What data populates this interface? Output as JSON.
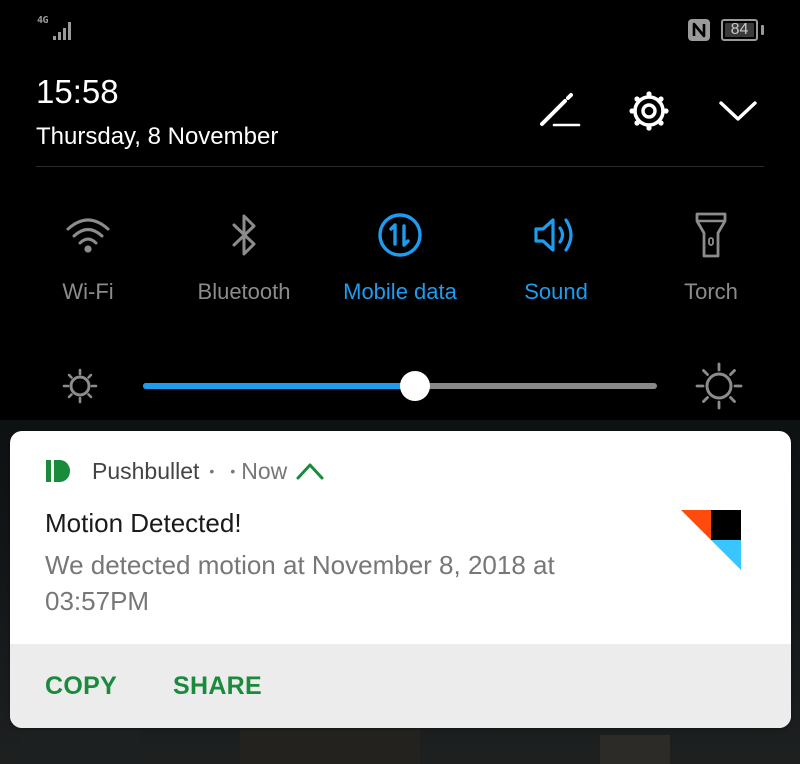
{
  "status_bar": {
    "network_type": "4G",
    "signal_icon": "signal-strength-icon",
    "nfc_icon": "nfc-icon",
    "battery_level": "84"
  },
  "header": {
    "time": "15:58",
    "date": "Thursday, 8 November",
    "edit_icon": "pencil-icon",
    "settings_icon": "gear-icon",
    "collapse_icon": "chevron-down-icon"
  },
  "quick_settings": {
    "tiles": [
      {
        "label": "Wi-Fi",
        "icon": "wifi-icon",
        "active": false
      },
      {
        "label": "Bluetooth",
        "icon": "bluetooth-icon",
        "active": false
      },
      {
        "label": "Mobile data",
        "icon": "mobile-data-icon",
        "active": true
      },
      {
        "label": "Sound",
        "icon": "speaker-icon",
        "active": true
      },
      {
        "label": "Torch",
        "icon": "flashlight-icon",
        "active": false
      }
    ],
    "accent_color": "#1e9cf0",
    "inactive_color": "#8c8c8c"
  },
  "brightness": {
    "level_percent": 53,
    "low_icon": "brightness-low-icon",
    "high_icon": "brightness-high-icon"
  },
  "notification": {
    "app_name": "Pushbullet",
    "separator": "•",
    "time": "Now",
    "title": "Motion Detected!",
    "body": "We detected motion at November 8, 2018 at 03:57PM",
    "app_color": "#1a8a3c",
    "actions": [
      {
        "label": "COPY"
      },
      {
        "label": "SHARE"
      }
    ]
  }
}
